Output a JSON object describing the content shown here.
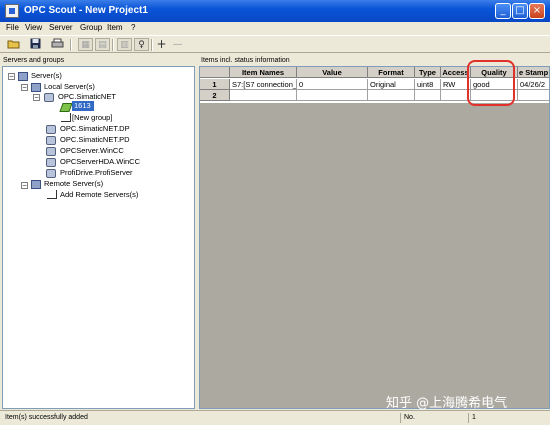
{
  "window": {
    "title": "OPC Scout - New Project1"
  },
  "menu": [
    "File",
    "View",
    "Server",
    "Group",
    "Item",
    "?"
  ],
  "toolbar": {
    "icons": [
      "open-folder",
      "save",
      "print",
      "server-props",
      "group-props",
      "item-props",
      "bulb",
      "add",
      "remove"
    ],
    "glyphs": {
      "add": "+",
      "remove": "—",
      "bulb": "♀"
    }
  },
  "left_panel": {
    "header": "Servers and groups"
  },
  "tree": [
    {
      "label": "Server(s)",
      "expander": "−"
    },
    {
      "label": "Local Server(s)",
      "expander": "−"
    },
    {
      "label": "OPC.SimaticNET",
      "expander": "−"
    },
    {
      "label": "1613",
      "selected": true
    },
    {
      "label": "[New group]"
    },
    {
      "label": "OPC.SimaticNET.DP"
    },
    {
      "label": "OPC.SimaticNET.PD"
    },
    {
      "label": "OPCServer.WinCC"
    },
    {
      "label": "OPCServerHDA.WinCC"
    },
    {
      "label": "ProfiDrive.ProfiServer"
    },
    {
      "label": "Remote Server(s)",
      "expander": "−"
    },
    {
      "label": "Add Remote Servers(s)"
    }
  ],
  "right_panel": {
    "header": "Items incl. status information"
  },
  "table": {
    "columns": [
      "Item Names",
      "Value",
      "Format",
      "Type",
      "Access",
      "Quality",
      "e Stamp"
    ],
    "rows": [
      {
        "num": "1",
        "cells": [
          "S7:[S7 connection_",
          "0",
          "Original",
          "uint8",
          "RW",
          "good",
          "04/26/2"
        ]
      },
      {
        "num": "2",
        "cells": [
          "",
          "",
          "",
          "",
          "",
          "",
          ""
        ]
      }
    ]
  },
  "watermark": "知乎 @上海腾希电气",
  "status": {
    "message": "Item(s) successfully added",
    "no_label": "No.",
    "count": "1"
  },
  "colors": {
    "highlight": "#e0322b",
    "selection": "#316ac5",
    "titlebar": "#0a55d8"
  }
}
